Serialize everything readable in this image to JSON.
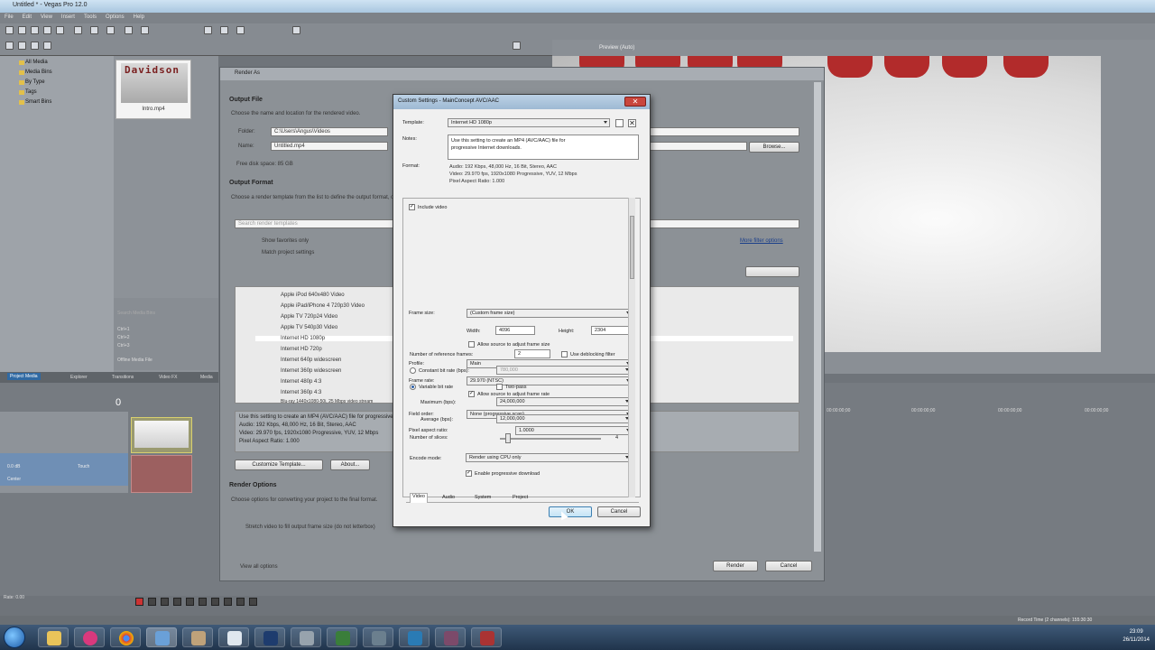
{
  "window": {
    "title": "Untitled * - Vegas Pro 12.0"
  },
  "menubar": [
    "File",
    "Edit",
    "View",
    "Insert",
    "Tools",
    "Options",
    "Help"
  ],
  "media_tree": [
    "All Media",
    "Media Bins",
    "By Type",
    "Tags",
    "Smart Bins"
  ],
  "media_thumb": {
    "overlay_text": "Davidson",
    "caption": "Intro.mp4"
  },
  "lower_left": {
    "search_placeholder": "Search Media Bins",
    "items": [
      "Ctrl+1",
      "Ctrl+2",
      "Ctrl+3"
    ],
    "offline": "Offline Media File"
  },
  "tabs": [
    "Project Media",
    "Explorer",
    "Transitions",
    "Video FX",
    "Media"
  ],
  "preview": {
    "mode_label": "Preview (Auto)"
  },
  "timeline": {
    "position": "0",
    "track1": {
      "level": "0.0 dB",
      "pan": "Touch",
      "center": "Center"
    },
    "ruler": [
      "00:00:00;00",
      "00:00:00;00",
      "00:00:00;00",
      "00:00:00;00"
    ],
    "rate": "Rate: 0.00",
    "record_time": "Record Time (2 channels): 155:30:30"
  },
  "render_as": {
    "title": "Render As",
    "output_file": {
      "heading": "Output File",
      "desc": "Choose the name and location for the rendered video.",
      "folder_label": "Folder:",
      "folder": "C:\\Users\\Angus\\Videos",
      "name_label": "Name:",
      "name": "Untitled.mp4",
      "browse": "Browse...",
      "free_space": "Free disk space: 85 GB"
    },
    "output_format": {
      "heading": "Output Format",
      "desc": "Choose a render template from the list to define the output format, or use one or more filter options to refine the list.",
      "search_placeholder": "Search render templates",
      "filter_favorites": "Show favorites only",
      "filter_match": "Match project settings",
      "filter_link": "More filter options",
      "templates": [
        "Apple iPod 640x480 Video",
        "Apple iPad/iPhone 4 720p30 Video",
        "Apple TV 720p24 Video",
        "Apple TV 540p30 Video",
        "Internet HD 1080p",
        "Internet HD 720p",
        "Internet 640p widescreen",
        "Internet 360p widescreen",
        "Internet 480p 4:3",
        "Internet 360p 4:3",
        "Blu-ray 1440x1080-50i, 25 Mbps video stream"
      ],
      "selected_index": 4,
      "selected_desc": [
        "Use this setting to create an MP4 (AVC/AAC) file for progressive Internet downloads.",
        "Audio: 192 Kbps, 48,000 Hz, 16 Bit, Stereo, AAC",
        "Video: 29.970 fps, 1920x1080 Progressive, YUV, 12 Mbps",
        "Pixel Aspect Ratio: 1.000"
      ],
      "customize": "Customize Template...",
      "about": "About..."
    },
    "render_options": {
      "heading": "Render Options",
      "desc": "Choose options for converting your project to the final format.",
      "opt2": "Stretch video to fill output frame size (do not letterbox)"
    },
    "view_all": "View all options",
    "render_btn": "Render",
    "cancel_btn": "Cancel"
  },
  "custom": {
    "title": "Custom Settings - MainConcept AVC/AAC",
    "template_label": "Template:",
    "template": "Internet HD 1080p",
    "notes_label": "Notes:",
    "notes": [
      "Use this setting to create an MP4 (AVC/AAC) file for",
      "progressive Internet downloads."
    ],
    "format_label": "Format:",
    "format": [
      "Audio: 192 Kbps, 48,000 Hz, 16 Bit, Stereo, AAC",
      "Video: 29.970 fps, 1920x1080 Progressive, YUV, 12 Mbps",
      "Pixel Aspect Ratio: 1.000"
    ],
    "include_video": "Include video",
    "frame_size_label": "Frame size:",
    "frame_size": "(Custom frame size)",
    "width_label": "Width:",
    "width": "4096",
    "height_label": "Height:",
    "height": "2304",
    "allow_frame_size": "Allow source to adjust frame size",
    "profile_label": "Profile:",
    "profile": "Main",
    "frame_rate_label": "Frame rate:",
    "frame_rate": "29.970 (NTSC)",
    "allow_frame_rate": "Allow source to adjust frame rate",
    "field_order_label": "Field order:",
    "field_order": "None (progressive scan)",
    "par_label": "Pixel aspect ratio:",
    "par": "1.0000",
    "ref_frames_label": "Number of reference frames:",
    "ref_frames": "2",
    "deblock": "Use deblocking filter",
    "cbr_label": "Constant bit rate (bps):",
    "cbr": "780,000",
    "vbr_label": "Variable bit rate",
    "two_pass": "Two-pass",
    "max_label": "Maximum (bps):",
    "max": "24,000,000",
    "avg_label": "Average (bps):",
    "avg": "12,000,000",
    "slices_label": "Number of slices:",
    "slices": "4",
    "encode_label": "Encode mode:",
    "encode": "Render using CPU only",
    "progressive_dl": "Enable progressive download",
    "tabs": [
      "Video",
      "Audio",
      "System",
      "Project"
    ],
    "ok": "OK",
    "cancel": "Cancel"
  },
  "taskbar": {
    "time": "23:09",
    "date": "26/11/2014"
  }
}
